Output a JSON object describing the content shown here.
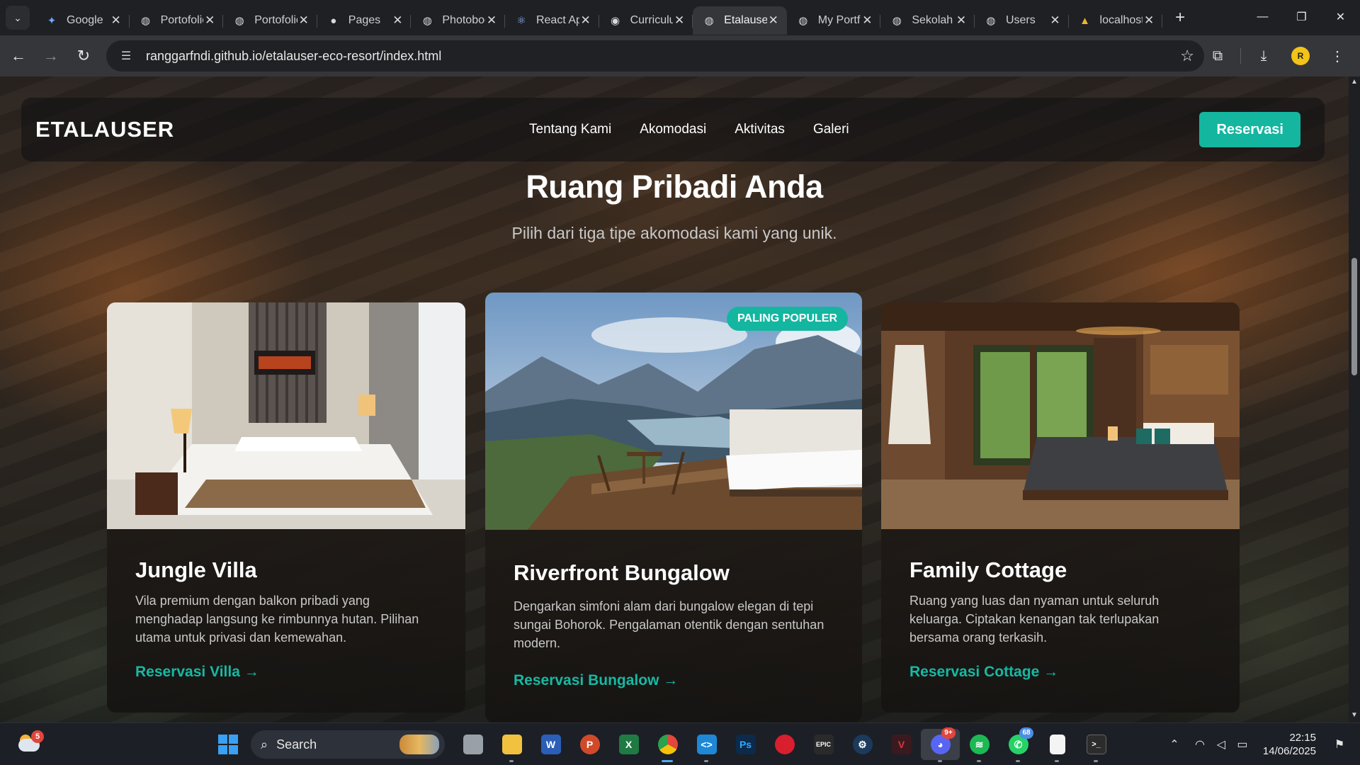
{
  "browser": {
    "tabs": [
      {
        "title": "Google",
        "icon": "gemini-icon"
      },
      {
        "title": "Portofolio",
        "icon": "globe-icon"
      },
      {
        "title": "Portofolio",
        "icon": "globe-icon"
      },
      {
        "title": "Pages",
        "icon": "github-icon"
      },
      {
        "title": "Photoboot",
        "icon": "globe-icon"
      },
      {
        "title": "React App",
        "icon": "react-icon"
      },
      {
        "title": "Curriculum",
        "icon": "globe-dark-icon"
      },
      {
        "title": "Etalauser",
        "icon": "globe-icon",
        "active": true
      },
      {
        "title": "My Portfolio",
        "icon": "globe-icon"
      },
      {
        "title": "Sekolah",
        "icon": "globe-icon"
      },
      {
        "title": "Users",
        "icon": "globe-icon"
      },
      {
        "title": "localhost",
        "icon": "vite-icon"
      }
    ],
    "url": "ranggarfndi.github.io/etalauser-eco-resort/index.html",
    "profile_initial": "R"
  },
  "site": {
    "logo": "ETALAUSER",
    "nav": [
      "Tentang Kami",
      "Akomodasi",
      "Aktivitas",
      "Galeri"
    ],
    "cta": "Reservasi",
    "section_title": "Ruang Pribadi Anda",
    "section_subtitle": "Pilih dari tiga tipe akomodasi kami yang unik.",
    "cards": [
      {
        "title": "Jungle Villa",
        "desc": "Vila premium dengan balkon pribadi yang menghadap langsung ke rimbunnya hutan. Pilihan utama untuk privasi dan kemewahan.",
        "link": "Reservasi Villa →"
      },
      {
        "title": "Riverfront Bungalow",
        "badge": "PALING POPULER",
        "desc": "Dengarkan simfoni alam dari bungalow elegan di tepi sungai Bohorok. Pengalaman otentik dengan sentuhan modern.",
        "link": "Reservasi Bungalow →"
      },
      {
        "title": "Family Cottage",
        "desc": "Ruang yang luas dan nyaman untuk seluruh keluarga. Ciptakan kenangan tak terlupakan bersama orang terkasih.",
        "link": "Reservasi Cottage →"
      }
    ]
  },
  "taskbar": {
    "weather_badge": "5",
    "search_label": "Search",
    "discord_badge": "9+",
    "whatsapp_badge": "68",
    "time": "22:15",
    "date": "14/06/2025"
  },
  "colors": {
    "accent": "#14b6a0",
    "link": "#17b9a3",
    "chrome_dark": "#1f2024",
    "chrome_toolbar": "#35363a"
  }
}
